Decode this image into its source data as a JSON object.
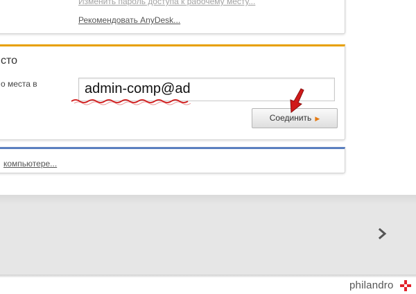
{
  "links": {
    "change_password": "Изменить пароль доступа к рабочему месту...",
    "recommend": "Рекомендовать AnyDesk...",
    "remote": "компьютере..."
  },
  "connect_panel": {
    "title": "сто",
    "description": "о места в",
    "address_value": "admin-comp@ad",
    "connect_label": "Соединить"
  },
  "colors": {
    "connect_accent": "#e8a000",
    "remote_accent": "#5a7fbf",
    "annotation_red": "#d01a1a",
    "logo_red": "#e3222b"
  },
  "icons": {
    "connect_arrow": "triangle-right-icon",
    "next": "chevron-right-icon",
    "pointer": "red-arrow-icon"
  },
  "footer": {
    "logo_text": "philandro"
  }
}
